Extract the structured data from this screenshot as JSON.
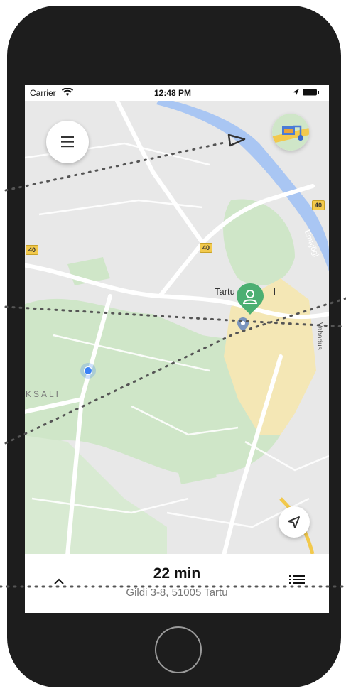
{
  "status_bar": {
    "carrier": "Carrier",
    "time": "12:48 PM"
  },
  "map": {
    "place_label": "Tartu",
    "place_label_suffix": "l",
    "district_label": "KSALI",
    "river_label": "Emajõgi",
    "street_label": "Vabadus",
    "speed_sign_1": "40",
    "speed_sign_2": "40",
    "speed_sign_3": "40"
  },
  "route_panel": {
    "duration": "22 min",
    "address": "Gildi 3-8, 51005 Tartu"
  },
  "colors": {
    "map_background": "#e8e8e8",
    "park": "#cfe6c8",
    "river": "#a9c6f3",
    "road": "#ffffff",
    "destination_pin": "#4caf72",
    "user_location": "#3b82f6",
    "phone_frame": "#1d1d1d"
  },
  "icons": [
    "menu-icon",
    "map-layers-icon",
    "destination-pin-icon",
    "user-location-icon",
    "current-location-arrow-icon",
    "chevron-up-icon",
    "list-icon",
    "wifi-icon",
    "location-arrow-icon",
    "battery-icon"
  ]
}
